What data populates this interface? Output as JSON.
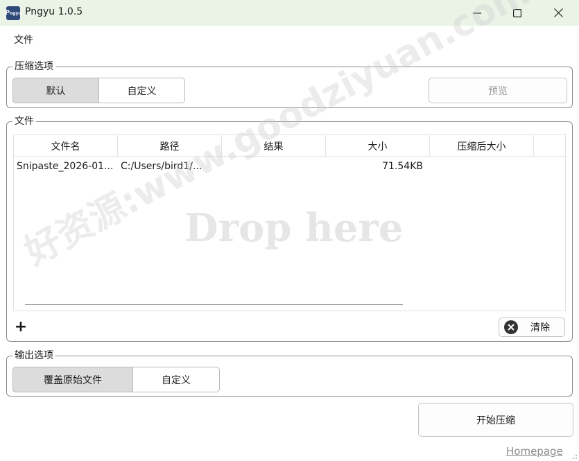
{
  "window": {
    "title": "Pngyu 1.0.5",
    "app_icon_text": "P",
    "app_icon_subtext": "ngyu"
  },
  "menu": {
    "file": "文件"
  },
  "compression_options": {
    "label": "压缩选项",
    "default_label": "默认",
    "custom_label": "自定义",
    "preview_label": "预览"
  },
  "files": {
    "label": "文件",
    "columns": [
      "文件名",
      "路径",
      "结果",
      "大小",
      "压缩后大小"
    ],
    "rows": [
      {
        "name": "Snipaste_2026-01...",
        "path": "C:/Users/bird1/...",
        "result": "",
        "size": "71.54KB",
        "compressed_size": ""
      }
    ],
    "drop_hint": "Drop here",
    "add_label": "+",
    "clear_label": "清除"
  },
  "output_options": {
    "label": "输出选项",
    "overwrite_label": "覆盖原始文件",
    "custom_label": "自定义"
  },
  "actions": {
    "start_label": "开始压缩",
    "homepage_label": "Homepage"
  },
  "watermark": "好资源:www.goodziyuan.com",
  "colors": {
    "titlebar_bg": "#eaf4e6",
    "active_segment": "#dcdcdc"
  }
}
